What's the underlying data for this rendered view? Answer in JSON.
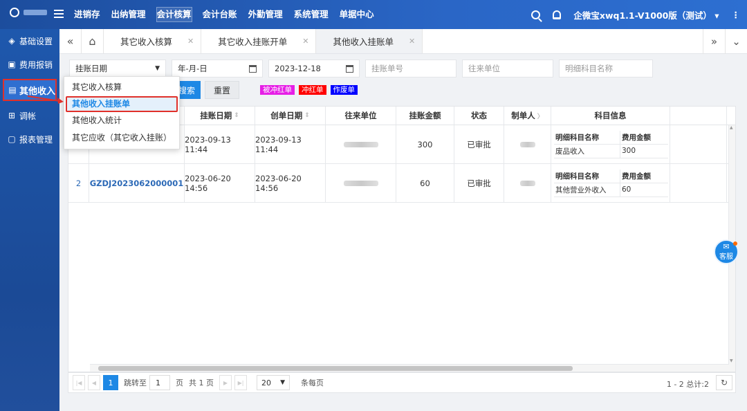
{
  "topbar": {
    "nav": [
      "进销存",
      "出纳管理",
      "会计核算",
      "会计台账",
      "外勤管理",
      "系统管理",
      "单据中心"
    ],
    "active_nav": "会计核算",
    "company": "企微宝xwq1.1-V1000版（测试）"
  },
  "sidebar": {
    "items": [
      {
        "label": "基础设置",
        "icon": "layers-icon"
      },
      {
        "label": "费用报销",
        "icon": "wallet-icon"
      },
      {
        "label": "其他收入",
        "icon": "income-icon"
      },
      {
        "label": "调帐",
        "icon": "adjust-icon"
      },
      {
        "label": "报表管理",
        "icon": "report-icon"
      }
    ]
  },
  "tabs": [
    {
      "label": "其它收入核算"
    },
    {
      "label": "其它收入挂账开单"
    },
    {
      "label": "其他收入挂账单"
    }
  ],
  "filters": {
    "date_type": "挂账日期",
    "start_date_placeholder": "年-月-日",
    "end_date": "2023-12-18",
    "doc_no_placeholder": "挂账单号",
    "partner_placeholder": "往来单位",
    "subject_placeholder": "明细科目名称"
  },
  "buttons": {
    "search": "搜索",
    "reset": "重置"
  },
  "legend": [
    {
      "label": "被冲红单",
      "color": "#e61ee6"
    },
    {
      "label": "冲红单",
      "color": "#ff0000"
    },
    {
      "label": "作废单",
      "color": "#0000ff"
    }
  ],
  "table": {
    "headers": [
      "挂账日期",
      "创单日期",
      "往来单位",
      "挂账金额",
      "状态",
      "制单人",
      "科目信息"
    ],
    "sub_headers": [
      "明细科目名称",
      "费用金额"
    ],
    "rows": [
      {
        "idx": "",
        "doc_no": "",
        "post_date": "2023-09-13 11:44",
        "create_date": "2023-09-13 11:44",
        "amount": "300",
        "status": "已审批",
        "subject": "废品收入",
        "fee": "300"
      },
      {
        "idx": "2",
        "doc_no": "GZDJ2023062000001",
        "post_date": "2023-06-20 14:56",
        "create_date": "2023-06-20 14:56",
        "amount": "60",
        "status": "已审批",
        "subject": "其他营业外收入",
        "fee": "60"
      }
    ]
  },
  "pagination": {
    "current": "1",
    "jump_label": "跳转至",
    "jump_value": "1",
    "page_unit": "页",
    "total_pages": "共 1 页",
    "page_size": "20",
    "per_page": "条每页",
    "summary": "1 - 2 总计:2"
  },
  "dropdown": {
    "items": [
      "其它收入核算",
      "其他收入挂账单",
      "其他收入统计",
      "其它应收（其它收入挂账）"
    ],
    "active_index": 1
  },
  "kefu_label": "客服"
}
